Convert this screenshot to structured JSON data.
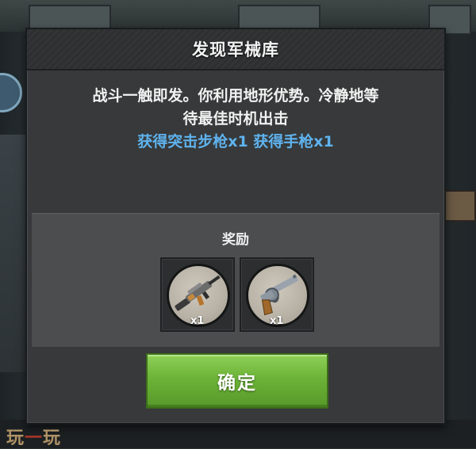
{
  "dialog": {
    "title": "发现军械库",
    "story_line1": "战斗一触即发。你利用地形优势。冷静地等",
    "story_line2": "待最佳时机出击",
    "reward_summary": "获得突击步枪x1 获得手枪x1",
    "rewards_label": "奖励",
    "rewards": [
      {
        "name": "突击步枪",
        "icon": "assault-rifle-icon",
        "quantity": "x1"
      },
      {
        "name": "手枪",
        "icon": "revolver-icon",
        "quantity": "x1"
      }
    ],
    "confirm_label": "确定"
  },
  "watermark": {
    "left": "玩",
    "mid": "一",
    "right": "玩"
  },
  "colors": {
    "reward_text": "#5fb3ee",
    "confirm_button": "#6cb337",
    "dialog_bg": "#37393a"
  }
}
